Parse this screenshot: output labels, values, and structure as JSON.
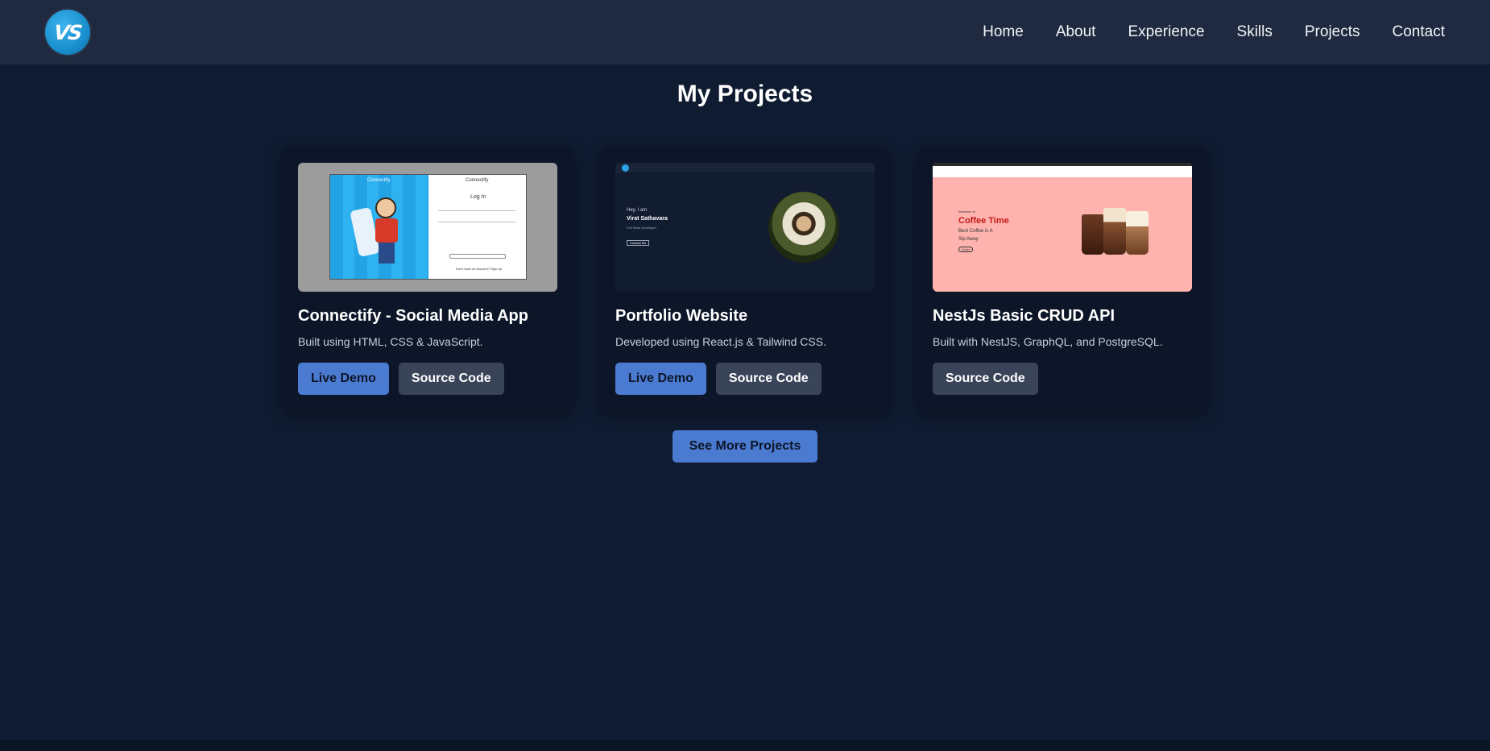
{
  "nav": {
    "logo_text": "VS",
    "links": [
      "Home",
      "About",
      "Experience",
      "Skills",
      "Projects",
      "Contact"
    ]
  },
  "section": {
    "title": "My Projects"
  },
  "projects": [
    {
      "title": "Connectify - Social Media App",
      "description": "Built using HTML, CSS & JavaScript.",
      "live_demo": "Live Demo",
      "source_code": "Source Code",
      "thumb": {
        "brand_left": "Connectify",
        "brand_right": "Connectify",
        "heading": "Log In",
        "footer": "Don't have an account? Sign Up"
      }
    },
    {
      "title": "Portfolio Website",
      "description": "Developed using React.js & Tailwind CSS.",
      "live_demo": "Live Demo",
      "source_code": "Source Code",
      "thumb": {
        "greeting": "Hey, I am",
        "name": "Virat Sathavara",
        "role": "Full Stack Developer",
        "button": "Contact Me"
      }
    },
    {
      "title": "NestJs Basic CRUD API",
      "description": "Built with NestJS, GraphQL, and PostgreSQL.",
      "source_code": "Source Code",
      "thumb": {
        "small": "Welcome to",
        "heading": "Coffee Time",
        "line1": "Best Coffee is A",
        "line2": "Sip Away",
        "button": "Order"
      }
    }
  ],
  "see_more": "See More Projects",
  "colors": {
    "page_bg": "#0f1b31",
    "nav_bg": "#1f2a40",
    "card_bg": "#0c1628",
    "primary": "#4b7bd0",
    "secondary": "#3a4459"
  }
}
